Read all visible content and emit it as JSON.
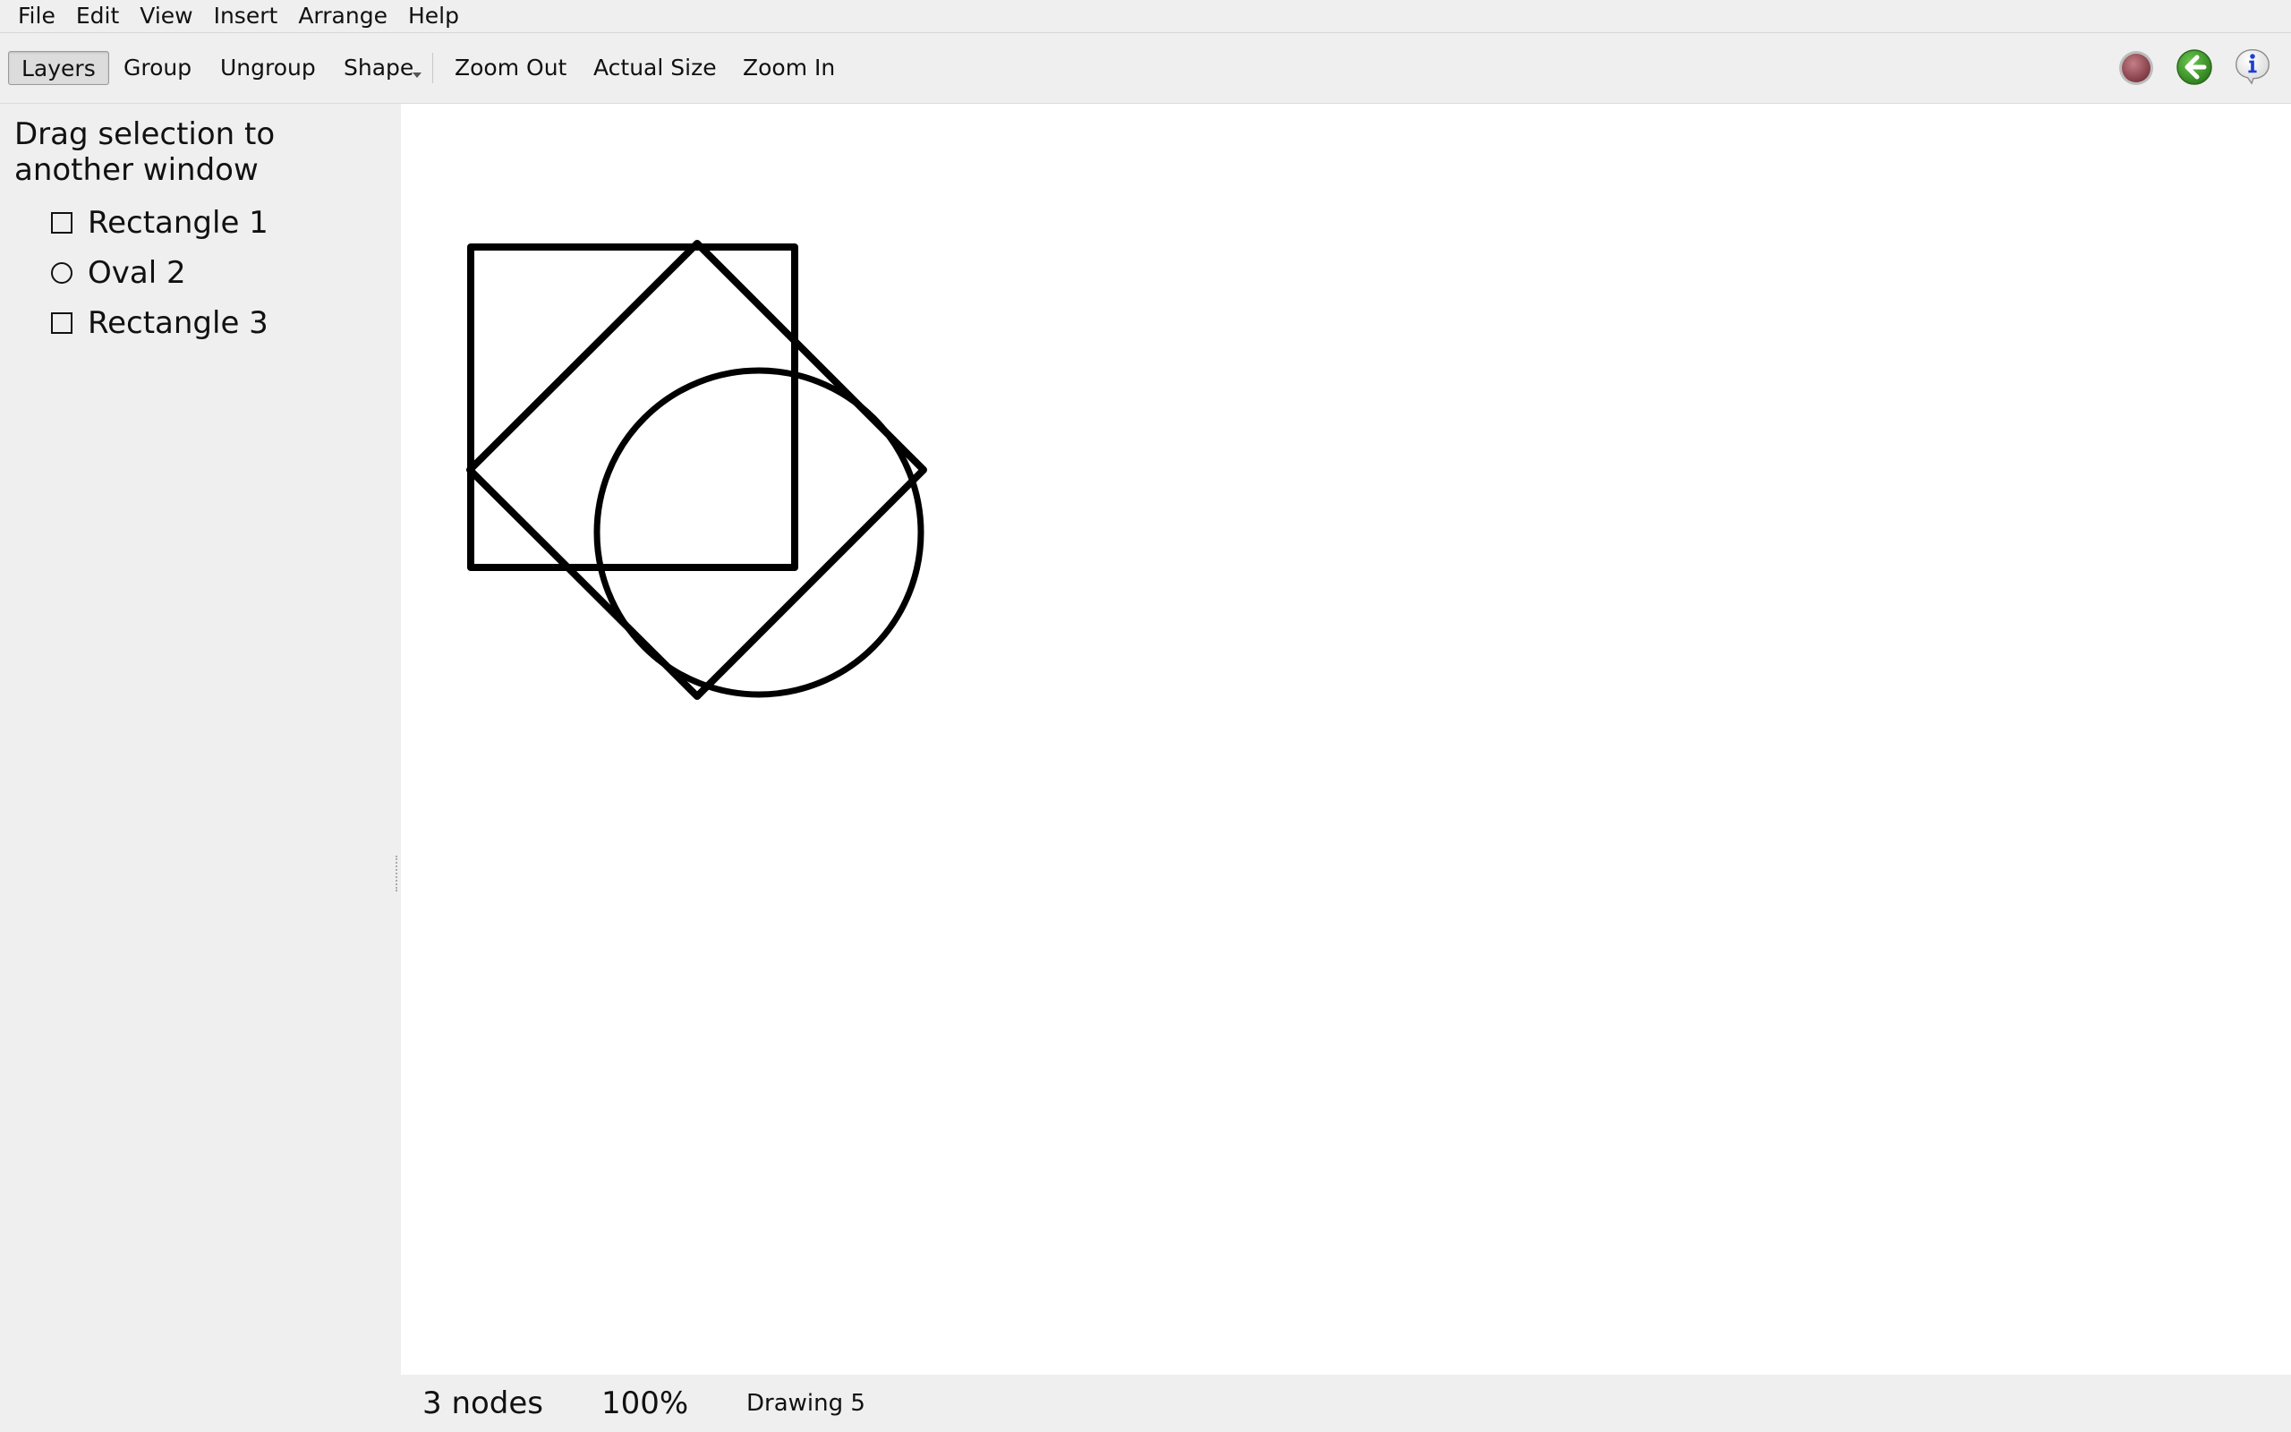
{
  "menubar": {
    "items": [
      "File",
      "Edit",
      "View",
      "Insert",
      "Arrange",
      "Help"
    ]
  },
  "toolbar": {
    "layers_label": "Layers",
    "group_label": "Group",
    "ungroup_label": "Ungroup",
    "shape_label": "Shape",
    "zoom_out_label": "Zoom Out",
    "actual_size_label": "Actual Size",
    "zoom_in_label": "Zoom In",
    "right_icons": [
      "record-stop-icon",
      "back-arrow-icon",
      "info-icon"
    ],
    "colors": {
      "record": "#a0545c",
      "back": "#3f9a2a",
      "info": "#1a3fd6"
    }
  },
  "sidepanel": {
    "hint": "Drag selection to another window",
    "layers": [
      {
        "label": "Rectangle 1",
        "icon": "square-icon"
      },
      {
        "label": "Oval 2",
        "icon": "circle-icon"
      },
      {
        "label": "Rectangle 3",
        "icon": "square-icon"
      }
    ]
  },
  "canvas": {
    "shapes": [
      {
        "name": "Rectangle 1",
        "kind": "rectangle"
      },
      {
        "name": "Oval 2",
        "kind": "oval"
      },
      {
        "name": "Rectangle 3",
        "kind": "rotated-rectangle"
      }
    ],
    "stroke_color": "#000000"
  },
  "statusbar": {
    "nodes": "3 nodes",
    "zoom": "100%",
    "document": "Drawing 5"
  }
}
